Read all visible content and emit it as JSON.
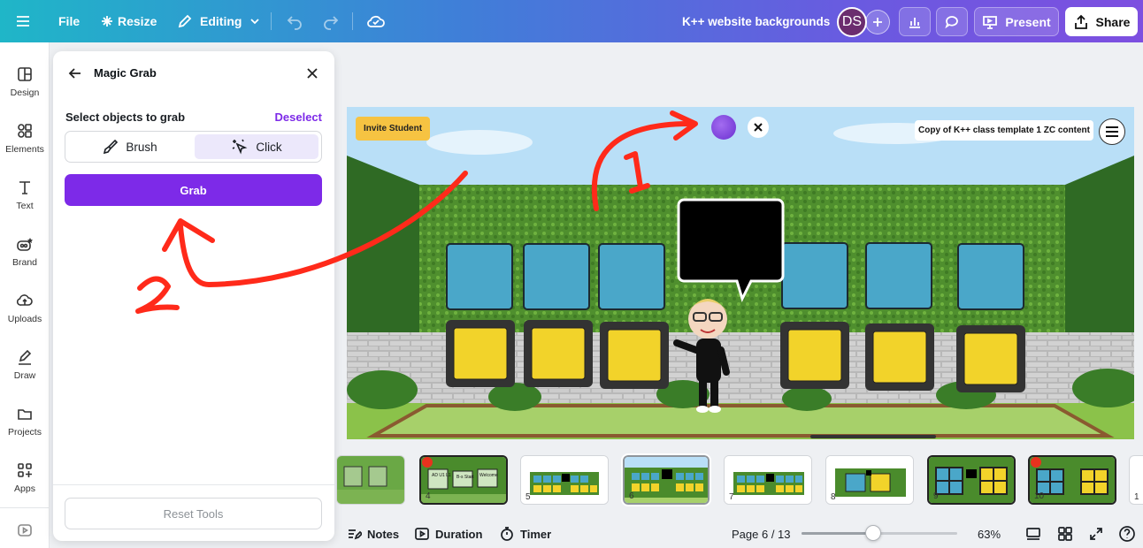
{
  "topbar": {
    "file_label": "File",
    "resize_label": "Resize",
    "mode_label": "Editing",
    "doc_title": "K++ website backgrounds",
    "avatar_initials": "DS",
    "present_label": "Present",
    "share_label": "Share"
  },
  "rail": {
    "items": [
      {
        "label": "Design",
        "icon": "layout-icon"
      },
      {
        "label": "Elements",
        "icon": "shapes-icon"
      },
      {
        "label": "Text",
        "icon": "text-icon"
      },
      {
        "label": "Brand",
        "icon": "brand-icon"
      },
      {
        "label": "Uploads",
        "icon": "cloud-upload-icon"
      },
      {
        "label": "Draw",
        "icon": "pen-icon"
      },
      {
        "label": "Projects",
        "icon": "folder-icon"
      },
      {
        "label": "Apps",
        "icon": "apps-icon"
      }
    ]
  },
  "panel": {
    "title": "Magic Grab",
    "section_label": "Select objects to grab",
    "deselect_label": "Deselect",
    "toggle": {
      "brush_label": "Brush",
      "click_label": "Click",
      "active": "click"
    },
    "grab_label": "Grab",
    "reset_label": "Reset Tools"
  },
  "canvas": {
    "badge_label": "Invite Student",
    "content_title": "Copy of K++ class template 1 ZC content",
    "annotations": {
      "arrow_one_label": "1",
      "arrow_two_label": "2"
    }
  },
  "filmstrip": {
    "pages": [
      "",
      "4",
      "5",
      "6",
      "7",
      "8",
      "9",
      "10",
      "1"
    ],
    "selected": "6",
    "page4_notes": [
      "AD U1 L1",
      "B-s Start",
      "Welcome"
    ]
  },
  "bottombar": {
    "notes_label": "Notes",
    "duration_label": "Duration",
    "timer_label": "Timer",
    "page_indicator": "Page 6 / 13",
    "zoom_percent": 63,
    "zoom_label": "63%"
  },
  "colors": {
    "accent": "#7d2ae8",
    "annotation_red": "#ff2a1a",
    "badge_yellow": "#f6c342"
  }
}
